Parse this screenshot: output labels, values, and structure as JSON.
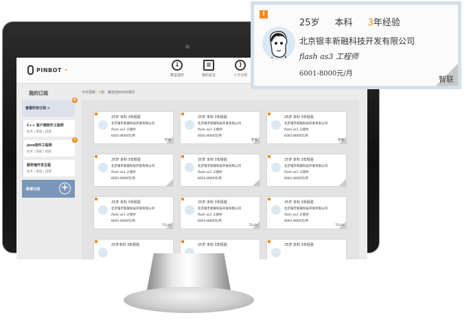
{
  "app": {
    "logo_text": "PINBOT"
  },
  "nav": [
    {
      "icon": "download-icon",
      "label": "聘宝插件"
    },
    {
      "icon": "calendar-icon",
      "label": "我的关注"
    },
    {
      "icon": "rss-icon",
      "label": "人才订阅"
    }
  ],
  "sidebar": {
    "title": "我的订阅",
    "view_all": "查看所有订阅 >",
    "subscriptions": [
      {
        "title": "C++ 客户端软件工程师",
        "meta": "技术 | 基础 | 成都",
        "badge": "8"
      },
      {
        "title": "java软件工程师",
        "meta": "技术 | 基础 | 成都",
        "badge": "8"
      },
      {
        "title": "服务端开发主程",
        "meta": "技术 | 基础 | 成都",
        "badge": ""
      }
    ],
    "add_label": "新增订阅",
    "add_icon": "plus-icon"
  },
  "summary": {
    "prefix": "今日更新：",
    "count": "8",
    "unit": "份",
    "note": "精选自600份简历"
  },
  "cards": [
    {
      "line1": "25岁    本科    3年经验",
      "company": "北京银丰新融科技开发有限公司",
      "title": "flash as3 工程师",
      "salary": "6001-8000元/月",
      "source": "智联"
    },
    {
      "line1": "25岁    本科    3年经验",
      "company": "北京银丰新融科技开发有限公司",
      "title": "flash as3 工程师",
      "salary": "6001-8000元/月",
      "source": "智联"
    },
    {
      "line1": "25岁    本科    3年经验",
      "company": "北京银丰新融科技开发有限公司",
      "title": "flash as3 工程师",
      "salary": "6001-8000元/月",
      "source": "智联"
    },
    {
      "line1": "25岁    本科    3年经验",
      "company": "北京银丰新融科技开发有限公司",
      "title": "flash as3 工程师",
      "salary": "6001-8000元/月",
      "source": ""
    },
    {
      "line1": "25岁    本科    3年经验",
      "company": "北京银丰新融科技开发有限公司",
      "title": "flash as3 工程师",
      "salary": "6001-8000元/月",
      "source": ""
    },
    {
      "line1": "25岁    本科    3年经验",
      "company": "北京银丰新融科技开发有限公司",
      "title": "flash as3 工程师",
      "salary": "6001-8000元/月",
      "source": ""
    },
    {
      "line1": "25岁    本科    3年经验",
      "company": "北京银丰新融科技开发有限公司",
      "title": "flash as3 工程师",
      "salary": "6001-8000元/月",
      "source": "51job"
    },
    {
      "line1": "25岁    本科    3年经验",
      "company": "北京银丰新融科技开发有限公司",
      "title": "flash as3 工程师",
      "salary": "6001-8000元/月",
      "source": "51job"
    },
    {
      "line1": "25岁    本科    3年经验",
      "company": "北京银丰新融科技开发有限公司",
      "title": "flash as3 工程师",
      "salary": "6001-8000元/月",
      "source": "51job"
    },
    {
      "line1": "25岁本科    3年经验",
      "company": "",
      "title": "",
      "salary": "",
      "source": ""
    },
    {
      "line1": "25岁    本科    3年经验",
      "company": "",
      "title": "",
      "salary": "",
      "source": ""
    },
    {
      "line1": "25岁    本科    3年经验",
      "company": "",
      "title": "",
      "salary": "",
      "source": ""
    }
  ],
  "popup": {
    "flag": "!",
    "age": "25岁",
    "edu": "本科",
    "exp_num": "3",
    "exp_unit": "年经验",
    "company": "北京银丰新融科技开发有限公司",
    "title": "flash as3 工程师",
    "salary": "6001-8000元/月",
    "source": "智联"
  },
  "colors": {
    "accent": "#f08c1e",
    "sidebar": "#dbe2ec",
    "add_button": "#7a96b8"
  }
}
